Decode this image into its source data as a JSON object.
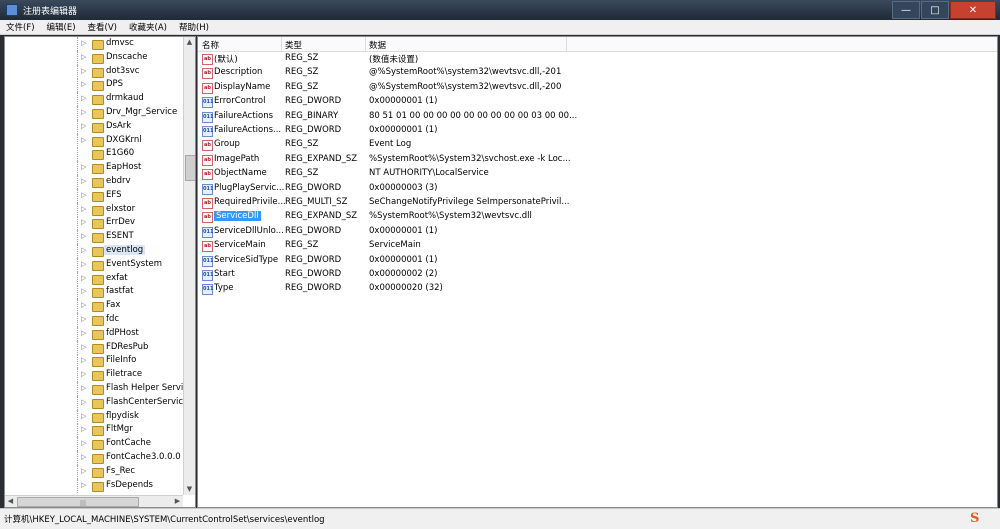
{
  "window": {
    "title": "注册表编辑器",
    "min": "—",
    "max": "□",
    "close": "✕"
  },
  "menu": [
    "文件(F)",
    "编辑(E)",
    "查看(V)",
    "收藏夹(A)",
    "帮助(H)"
  ],
  "tree": {
    "items": [
      {
        "label": "dmvsc",
        "expandable": true
      },
      {
        "label": "Dnscache",
        "expandable": true
      },
      {
        "label": "dot3svc",
        "expandable": true
      },
      {
        "label": "DPS",
        "expandable": true
      },
      {
        "label": "drmkaud",
        "expandable": true
      },
      {
        "label": "Drv_Mgr_Service",
        "expandable": true
      },
      {
        "label": "DsArk",
        "expandable": true
      },
      {
        "label": "DXGKrnl",
        "expandable": true
      },
      {
        "label": "E1G60",
        "expandable": false
      },
      {
        "label": "EapHost",
        "expandable": true
      },
      {
        "label": "ebdrv",
        "expandable": true
      },
      {
        "label": "EFS",
        "expandable": true
      },
      {
        "label": "elxstor",
        "expandable": true
      },
      {
        "label": "ErrDev",
        "expandable": true
      },
      {
        "label": "ESENT",
        "expandable": true
      },
      {
        "label": "eventlog",
        "expandable": true,
        "selected": true
      },
      {
        "label": "EventSystem",
        "expandable": true
      },
      {
        "label": "exfat",
        "expandable": true
      },
      {
        "label": "fastfat",
        "expandable": true
      },
      {
        "label": "Fax",
        "expandable": true
      },
      {
        "label": "fdc",
        "expandable": true
      },
      {
        "label": "fdPHost",
        "expandable": true
      },
      {
        "label": "FDResPub",
        "expandable": true
      },
      {
        "label": "FileInfo",
        "expandable": true
      },
      {
        "label": "Filetrace",
        "expandable": true
      },
      {
        "label": "Flash Helper Servic",
        "expandable": true
      },
      {
        "label": "FlashCenterService",
        "expandable": true
      },
      {
        "label": "flpydisk",
        "expandable": true
      },
      {
        "label": "FltMgr",
        "expandable": true
      },
      {
        "label": "FontCache",
        "expandable": true
      },
      {
        "label": "FontCache3.0.0.0",
        "expandable": true
      },
      {
        "label": "Fs_Rec",
        "expandable": true
      },
      {
        "label": "FsDepends",
        "expandable": true
      }
    ]
  },
  "columns": {
    "name": "名称",
    "type": "类型",
    "data": "数据"
  },
  "values": [
    {
      "icon": "ab",
      "name": "(默认)",
      "type": "REG_SZ",
      "data": "(数值未设置)"
    },
    {
      "icon": "ab",
      "name": "Description",
      "type": "REG_SZ",
      "data": "@%SystemRoot%\\system32\\wevtsvc.dll,-201"
    },
    {
      "icon": "ab",
      "name": "DisplayName",
      "type": "REG_SZ",
      "data": "@%SystemRoot%\\system32\\wevtsvc.dll,-200"
    },
    {
      "icon": "bin",
      "name": "ErrorControl",
      "type": "REG_DWORD",
      "data": "0x00000001 (1)"
    },
    {
      "icon": "bin",
      "name": "FailureActions",
      "type": "REG_BINARY",
      "data": "80 51 01 00 00 00 00 00 00 00 00 00 03 00 00..."
    },
    {
      "icon": "bin",
      "name": "FailureActions...",
      "type": "REG_DWORD",
      "data": "0x00000001 (1)"
    },
    {
      "icon": "ab",
      "name": "Group",
      "type": "REG_SZ",
      "data": "Event Log"
    },
    {
      "icon": "ab",
      "name": "ImagePath",
      "type": "REG_EXPAND_SZ",
      "data": "%SystemRoot%\\System32\\svchost.exe -k Loc..."
    },
    {
      "icon": "ab",
      "name": "ObjectName",
      "type": "REG_SZ",
      "data": "NT AUTHORITY\\LocalService"
    },
    {
      "icon": "bin",
      "name": "PlugPlayServic...",
      "type": "REG_DWORD",
      "data": "0x00000003 (3)"
    },
    {
      "icon": "ab",
      "name": "RequiredPrivile...",
      "type": "REG_MULTI_SZ",
      "data": "SeChangeNotifyPrivilege SeImpersonatePrivil..."
    },
    {
      "icon": "ab",
      "name": "ServiceDll",
      "type": "REG_EXPAND_SZ",
      "data": "%SystemRoot%\\System32\\wevtsvc.dll",
      "selected": true
    },
    {
      "icon": "bin",
      "name": "ServiceDllUnlo...",
      "type": "REG_DWORD",
      "data": "0x00000001 (1)"
    },
    {
      "icon": "ab",
      "name": "ServiceMain",
      "type": "REG_SZ",
      "data": "ServiceMain"
    },
    {
      "icon": "bin",
      "name": "ServiceSidType",
      "type": "REG_DWORD",
      "data": "0x00000001 (1)"
    },
    {
      "icon": "bin",
      "name": "Start",
      "type": "REG_DWORD",
      "data": "0x00000002 (2)"
    },
    {
      "icon": "bin",
      "name": "Type",
      "type": "REG_DWORD",
      "data": "0x00000020 (32)"
    }
  ],
  "status": {
    "path": "计算机\\HKEY_LOCAL_MACHINE\\SYSTEM\\CurrentControlSet\\services\\eventlog"
  }
}
